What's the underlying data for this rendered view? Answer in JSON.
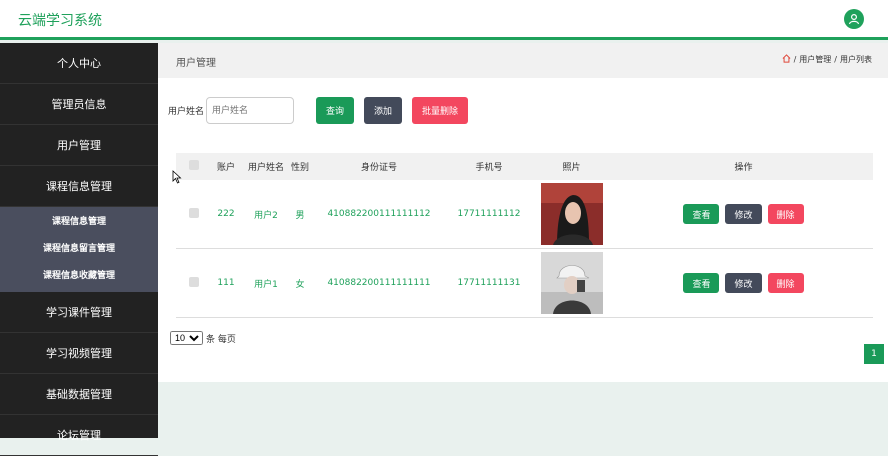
{
  "header": {
    "brand": "云端学习系统",
    "accent": "#1fa15b"
  },
  "sidebar": {
    "items": [
      {
        "label": "个人中心"
      },
      {
        "label": "管理员信息"
      },
      {
        "label": "用户管理"
      },
      {
        "label": "课程信息管理"
      }
    ],
    "submenu": [
      {
        "label": "课程信息管理"
      },
      {
        "label": "课程信息留言管理"
      },
      {
        "label": "课程信息收藏管理"
      }
    ],
    "items_after": [
      {
        "label": "学习课件管理"
      },
      {
        "label": "学习视频管理"
      },
      {
        "label": "基础数据管理"
      },
      {
        "label": "论坛管理"
      }
    ]
  },
  "page": {
    "title": "用户管理",
    "breadcrumb": [
      "用户管理",
      "用户列表"
    ]
  },
  "search": {
    "label": "用户姓名",
    "placeholder": "用户姓名",
    "query_button": "查询",
    "add_button": "添加",
    "batch_delete_button": "批量删除"
  },
  "table": {
    "headers": [
      "账户",
      "用户姓名",
      "性别",
      "身份证号",
      "手机号",
      "照片",
      "操作"
    ],
    "rows": [
      {
        "account": "222",
        "name": "用户2",
        "gender": "男",
        "id_number": "410882200111111112",
        "phone": "17711111112",
        "photo": "user-photo-2"
      },
      {
        "account": "111",
        "name": "用户1",
        "gender": "女",
        "id_number": "410882200111111111",
        "phone": "17711111131",
        "photo": "user-photo-1"
      }
    ],
    "actions": {
      "view": "查看",
      "edit": "修改",
      "delete": "删除"
    }
  },
  "pagination": {
    "page_size": "10",
    "per_page_label": "条 每页",
    "current_page": "1"
  }
}
